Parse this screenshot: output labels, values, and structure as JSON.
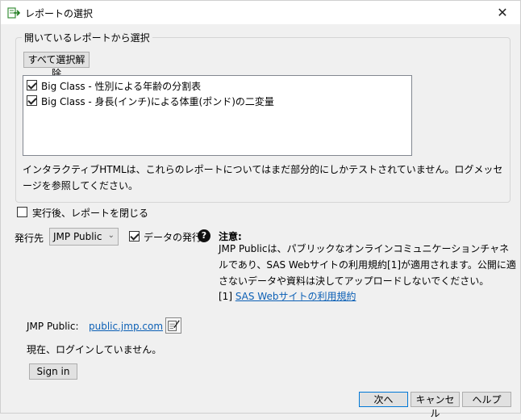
{
  "window": {
    "title": "レポートの選択",
    "close_glyph": "✕"
  },
  "group": {
    "title": "開いているレポートから選択",
    "deselect_all_label": "すべて選択解除",
    "reports": [
      {
        "label": "Big Class - 性別による年齢の分割表",
        "checked": true
      },
      {
        "label": "Big Class - 身長(インチ)による体重(ポンド)の二変量",
        "checked": true
      }
    ],
    "info_text": "インタラクティブHTMLは、これらのレポートについてはまだ部分的にしかテストされていません。ログメッセージを参照してください。"
  },
  "close_after_run": {
    "label": "実行後、レポートを閉じる",
    "checked": false
  },
  "publish": {
    "destination_label": "発行先",
    "destination_value": "JMP Public",
    "publish_data_label": "データの発行",
    "publish_data_checked": true,
    "help_glyph": "?"
  },
  "notice": {
    "title": "注意:",
    "body": "JMP Publicは、パブリックなオンラインコミュニケーションチャネルであり、SAS Webサイトの利用規約[1]が適用されます。公開に適さないデータや資料は決してアップロードしないでください。",
    "footnote_prefix": "[1] ",
    "footnote_link": "SAS Webサイトの利用規約"
  },
  "account": {
    "label": "JMP Public:",
    "url": "public.jmp.com",
    "status": "現在、ログインしていません。",
    "sign_in_label": "Sign in"
  },
  "footer": {
    "next_label": "次へ",
    "cancel_label": "キャンセル",
    "help_label": "ヘルプ"
  },
  "icons": {
    "app": "report-publish-icon",
    "edit": "edit-note-icon",
    "help": "question-circle-icon"
  }
}
